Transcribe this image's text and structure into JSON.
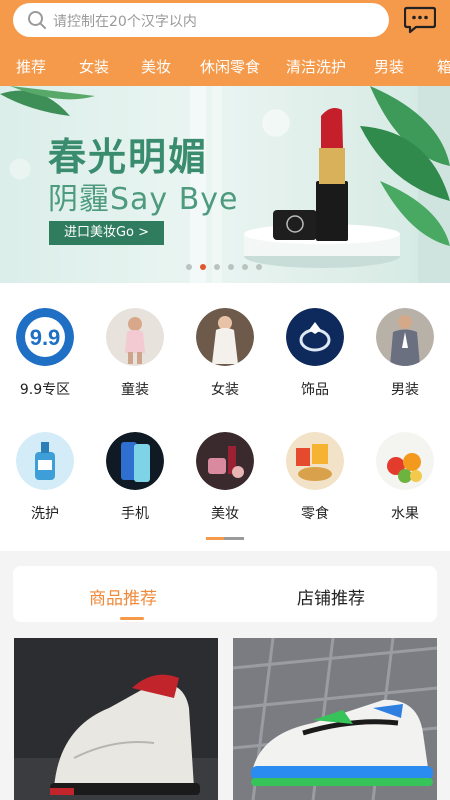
{
  "search": {
    "placeholder": "请控制在20个汉字以内",
    "search_icon": "search-icon",
    "message_icon": "message-icon"
  },
  "nav_tabs": [
    "推荐",
    "女装",
    "美妆",
    "休闲零食",
    "清洁洗护",
    "男装",
    "箱"
  ],
  "banner": {
    "title": "春光明媚",
    "subtitle": "阴霾Say Bye",
    "button": "进口美妆Go >",
    "slide_count": 6,
    "active_slide": 2
  },
  "categories": [
    {
      "label": "9.9专区",
      "icon": "nine-nine-icon"
    },
    {
      "label": "童装",
      "icon": "kids-clothing-icon"
    },
    {
      "label": "女装",
      "icon": "womens-clothing-icon"
    },
    {
      "label": "饰品",
      "icon": "jewelry-icon"
    },
    {
      "label": "男装",
      "icon": "mens-clothing-icon"
    },
    {
      "label": "洗护",
      "icon": "wash-care-icon"
    },
    {
      "label": "手机",
      "icon": "phone-icon"
    },
    {
      "label": "美妆",
      "icon": "makeup-icon"
    },
    {
      "label": "零食",
      "icon": "snacks-icon"
    },
    {
      "label": "水果",
      "icon": "fruit-icon"
    }
  ],
  "recommend": {
    "tabs": [
      "商品推荐",
      "店铺推荐"
    ],
    "active": 0
  },
  "products": [
    {
      "name": "basketball-shoe"
    },
    {
      "name": "running-shoe"
    }
  ],
  "colors": {
    "accent": "#f59a4b",
    "active_text": "#f08a3a",
    "banner_green": "#3a8c6e"
  }
}
